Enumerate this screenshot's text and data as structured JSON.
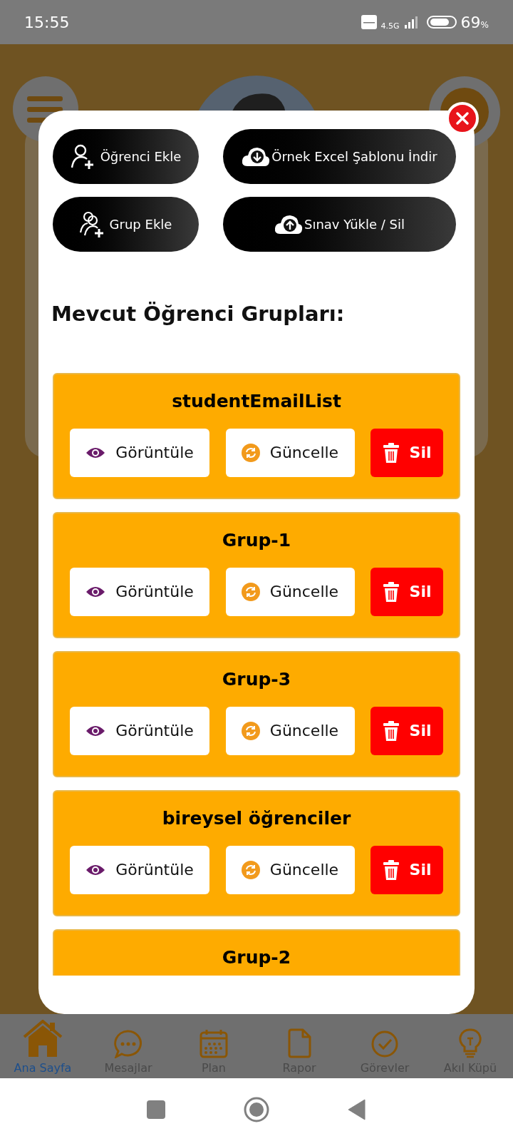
{
  "status_bar": {
    "time": "15:55",
    "network": "4.5G",
    "battery": "69",
    "battery_unit": "%"
  },
  "dialog": {
    "actions": [
      {
        "label": "Öğrenci Ekle",
        "kind": "person-add"
      },
      {
        "label": "Örnek Excel Şablonu İndir",
        "kind": "cloud-download"
      },
      {
        "label": "Grup Ekle",
        "kind": "group-add"
      },
      {
        "label": "Sınav Yükle / Sil",
        "kind": "cloud-upload"
      }
    ],
    "heading": "Mevcut Öğrenci Grupları:",
    "groups": [
      {
        "name": "studentEmailList",
        "buttons": [
          {
            "label": "Görüntüle",
            "kind": "view"
          },
          {
            "label": "Güncelle",
            "kind": "update"
          },
          {
            "label": "Sil",
            "kind": "delete"
          }
        ]
      },
      {
        "name": "Grup-1",
        "buttons": [
          {
            "label": "Görüntüle",
            "kind": "view"
          },
          {
            "label": "Güncelle",
            "kind": "update"
          },
          {
            "label": "Sil",
            "kind": "delete"
          }
        ]
      },
      {
        "name": "Grup-3",
        "buttons": [
          {
            "label": "Görüntüle",
            "kind": "view"
          },
          {
            "label": "Güncelle",
            "kind": "update"
          },
          {
            "label": "Sil",
            "kind": "delete"
          }
        ]
      },
      {
        "name": "bireysel öğrenciler",
        "buttons": [
          {
            "label": "Görüntüle",
            "kind": "view"
          },
          {
            "label": "Güncelle",
            "kind": "update"
          },
          {
            "label": "Sil",
            "kind": "delete"
          }
        ]
      },
      {
        "name": "Grup-2"
      }
    ]
  },
  "bottom_nav": [
    {
      "label": "Ana Sayfa",
      "kind": "home",
      "selected": true
    },
    {
      "label": "Mesajlar",
      "kind": "chat",
      "selected": false
    },
    {
      "label": "Plan",
      "kind": "calendar",
      "selected": false
    },
    {
      "label": "Rapor",
      "kind": "document",
      "selected": false
    },
    {
      "label": "Görevler",
      "kind": "check",
      "selected": false
    },
    {
      "label": "Akıl Küpü",
      "kind": "bulb",
      "selected": false
    }
  ]
}
